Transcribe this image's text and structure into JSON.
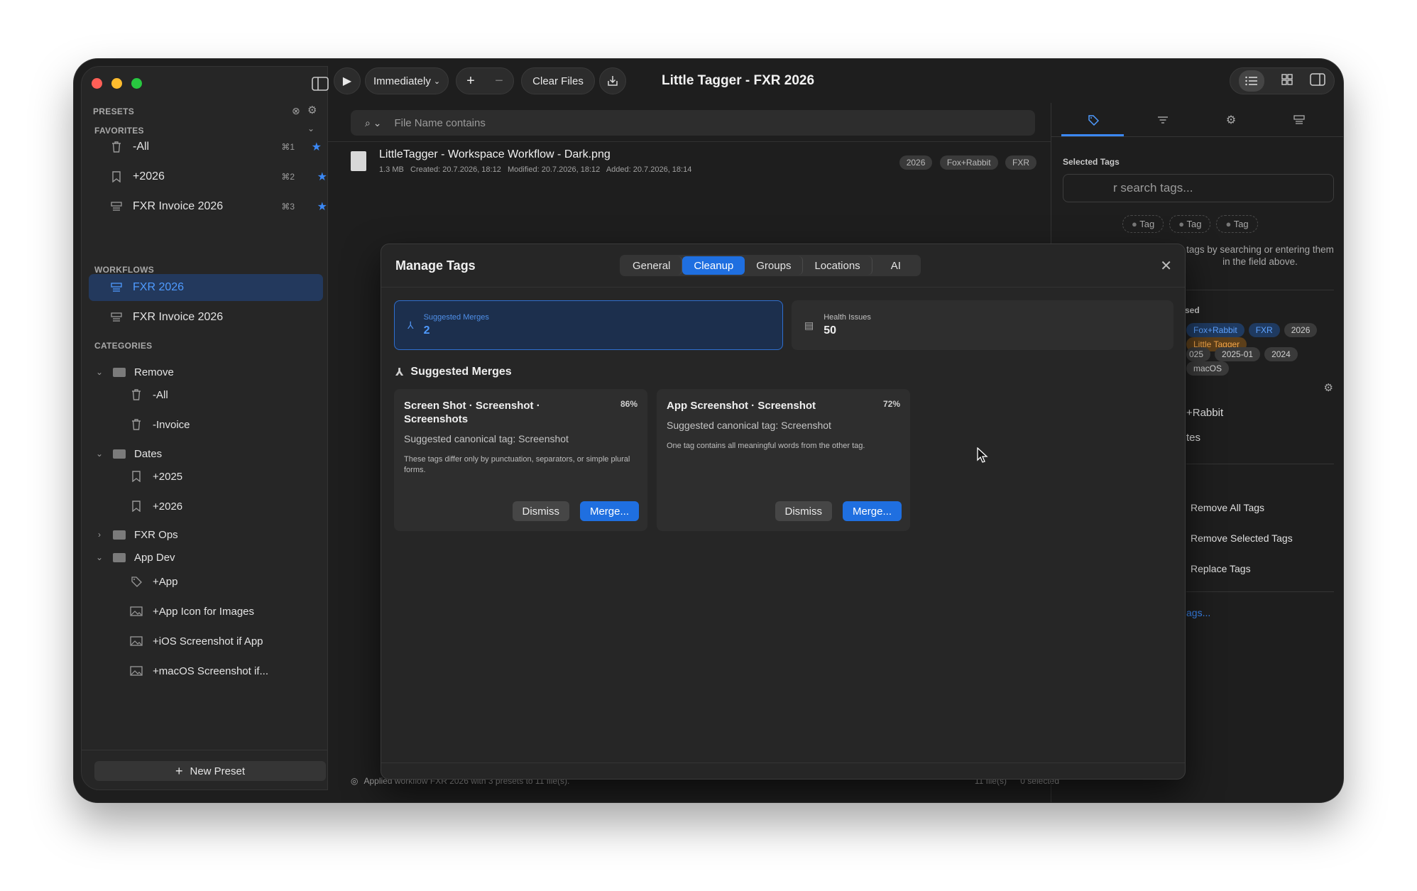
{
  "window": {
    "title": "Little Tagger - FXR 2026"
  },
  "toolbar": {
    "run_mode": "Immediately",
    "clear_files": "Clear Files"
  },
  "sidebar": {
    "presets_label": "PRESETS",
    "favorites_label": "FAVORITES",
    "favorites": [
      {
        "label": "-All",
        "shortcut": "⌘1"
      },
      {
        "label": "+2026",
        "shortcut": "⌘2"
      },
      {
        "label": "FXR Invoice 2026",
        "shortcut": "⌘3"
      }
    ],
    "workflows_label": "WORKFLOWS",
    "workflows": [
      {
        "label": "FXR 2026"
      },
      {
        "label": "FXR Invoice 2026"
      }
    ],
    "categories_label": "CATEGORIES",
    "categories": {
      "remove": {
        "label": "Remove",
        "items": [
          "-All",
          "-Invoice"
        ]
      },
      "dates": {
        "label": "Dates",
        "items": [
          "+2025",
          "+2026"
        ]
      },
      "fxr_ops": {
        "label": "FXR Ops"
      },
      "app_dev": {
        "label": "App Dev",
        "items": [
          "+App",
          "+App Icon for Images",
          "+iOS Screenshot if App",
          "+macOS Screenshot if..."
        ]
      }
    },
    "new_preset": "New Preset"
  },
  "search": {
    "placeholder": "File Name contains"
  },
  "files": [
    {
      "name": "LittleTagger - Workspace Workflow - Dark.png",
      "meta": "1.3 MB   Created: 20.7.2026, 18:12   Modified: 20.7.2026, 18:12   Added: 20.7.2026, 18:14",
      "tags": [
        "2026",
        "Fox+Rabbit",
        "FXR"
      ]
    }
  ],
  "status": {
    "message": "Applied workflow FXR 2026 with 3 presets to 11 file(s).",
    "file_count": "11 file(s)",
    "selected": "0 selected"
  },
  "right_panel": {
    "selected_tags_label": "Selected Tags",
    "search_placeholder": "r search tags...",
    "placeholder_tags": [
      "Tag",
      "Tag",
      "Tag"
    ],
    "hint": "tags by searching or entering them in the field above.",
    "used_label": "sed",
    "used_tags_row1": [
      "Fox+Rabbit",
      "FXR",
      "2026",
      "Little Tagger"
    ],
    "used_tags_row2": [
      "025",
      "2025-01",
      "2024",
      "macOS"
    ],
    "list_items": [
      "+Rabbit",
      "tes"
    ],
    "actions": [
      "Remove All Tags",
      "Remove Selected Tags",
      "Replace Tags"
    ],
    "link": "ags..."
  },
  "modal": {
    "title": "Manage Tags",
    "tabs": [
      "General",
      "Cleanup",
      "Groups",
      "Locations",
      "AI"
    ],
    "active_tab": "Cleanup",
    "stats": {
      "suggested_merges_label": "Suggested Merges",
      "suggested_merges_value": "2",
      "health_issues_label": "Health Issues",
      "health_issues_value": "50"
    },
    "section_title": "Suggested Merges",
    "merges": [
      {
        "title": "Screen Shot · Screenshot · Screenshots",
        "percent": "86%",
        "suggestion": "Suggested canonical tag: Screenshot",
        "description": "These tags differ only by punctuation, separators, or simple plural forms.",
        "dismiss": "Dismiss",
        "merge": "Merge..."
      },
      {
        "title": "App Screenshot · Screenshot",
        "percent": "72%",
        "suggestion": "Suggested canonical tag: Screenshot",
        "description": "One tag contains all meaningful words from the other tag.",
        "dismiss": "Dismiss",
        "merge": "Merge..."
      }
    ]
  },
  "colors": {
    "accent": "#1f6fe0",
    "selected_bg": "#23395d",
    "window_bg": "#1e1e1e"
  }
}
